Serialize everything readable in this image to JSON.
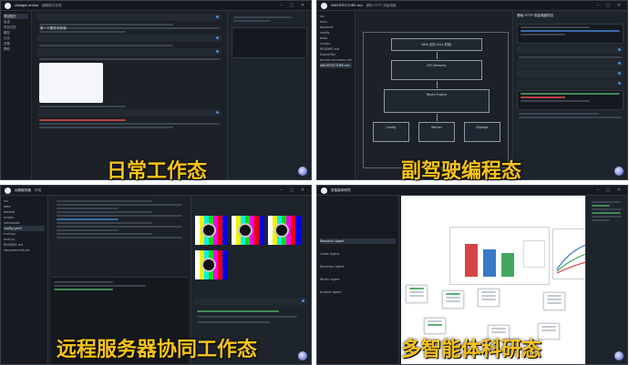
{
  "captions": {
    "daily": "日常工作态",
    "copilot": "副驾驶编程态",
    "remote": "远程服务器协同工作态",
    "multiagent": "多智能体科研态"
  },
  "colors": {
    "caption": "#f7c31b",
    "panel_bg": "#1c2128",
    "accent": "#4a8bd6"
  },
  "panel1": {
    "tabs": [
      "chatgpt-online",
      "编程助手标签"
    ],
    "header": "第一下图任务前端",
    "sidebar": [
      "项目知识",
      "会话",
      "项目文档",
      "模型",
      "日志",
      "设置",
      "帮助"
    ]
  },
  "panel2": {
    "tabs": [
      "ARCHITECTURE.md",
      "源码 HTTP 流量调度"
    ],
    "header": "基础 HTTP 流量调度项目",
    "files": [
      "src",
      "docs",
      "backend",
      "config",
      "tests",
      "scripts",
      "README.md",
      "Dockerfile",
      "docker-compose.yml",
      "ARCHITECTURE.md"
    ],
    "diagram_boxes": [
      "Web 应用 (Vue 前端)",
      "API Gateway",
      "Route Engine",
      "Config",
      "Worker",
      "Storage"
    ]
  },
  "panel3": {
    "tabs": [
      "远程服务器",
      "终端"
    ],
    "files": [
      "src",
      "data",
      "models",
      "scripts",
      "notebooks",
      "config.yaml",
      "train.py",
      "eval.py",
      "README.md",
      "requirements.txt"
    ]
  },
  "panel4": {
    "tabs": [
      "多智能体研究"
    ],
    "agents": [
      "Research Agent",
      "Coder Agent",
      "Reviewer Agent",
      "Writer Agent",
      "Analyst Agent"
    ]
  }
}
